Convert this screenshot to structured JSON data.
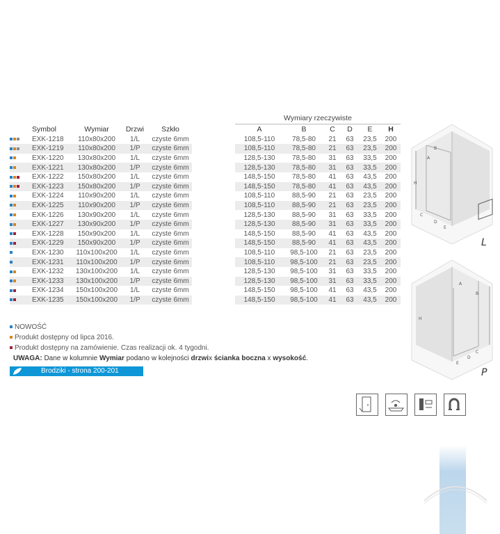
{
  "wymiary_title": "Wymiary rzeczywiste",
  "left_headers": [
    "Symbol",
    "Wymiar",
    "Drzwi",
    "Szkło"
  ],
  "right_headers": [
    "A",
    "B",
    "C",
    "D",
    "E",
    "H"
  ],
  "colors": {
    "nowosc": "#2a7fc1",
    "lipiec": "#d9841c",
    "zamowienie": "#a3203a",
    "gray": "#8a8a8a",
    "banner": "#0e96d6"
  },
  "rows": [
    {
      "symbol": "EXK-1218",
      "wymiar": "110x80x200",
      "drzwi": "1/L",
      "szklo": "czyste 6mm",
      "a": "108,5-110",
      "b": "78,5-80",
      "c": "21",
      "d": "63",
      "e": "23,5",
      "h": "200",
      "marks": [
        "nowosc",
        "lipiec",
        "gray"
      ]
    },
    {
      "symbol": "EXK-1219",
      "wymiar": "110x80x200",
      "drzwi": "1/P",
      "szklo": "czyste 6mm",
      "a": "108,5-110",
      "b": "78,5-80",
      "c": "21",
      "d": "63",
      "e": "23,5",
      "h": "200",
      "marks": [
        "nowosc",
        "lipiec",
        "gray"
      ]
    },
    {
      "symbol": "EXK-1220",
      "wymiar": "130x80x200",
      "drzwi": "1/L",
      "szklo": "czyste 6mm",
      "a": "128,5-130",
      "b": "78,5-80",
      "c": "31",
      "d": "63",
      "e": "33,5",
      "h": "200",
      "marks": [
        "nowosc",
        "lipiec"
      ]
    },
    {
      "symbol": "EXK-1221",
      "wymiar": "130x80x200",
      "drzwi": "1/P",
      "szklo": "czyste 6mm",
      "a": "128,5-130",
      "b": "78,5-80",
      "c": "31",
      "d": "63",
      "e": "33,5",
      "h": "200",
      "marks": [
        "nowosc",
        "lipiec"
      ]
    },
    {
      "symbol": "EXK-1222",
      "wymiar": "150x80x200",
      "drzwi": "1/L",
      "szklo": "czyste 6mm",
      "a": "148,5-150",
      "b": "78,5-80",
      "c": "41",
      "d": "63",
      "e": "43,5",
      "h": "200",
      "marks": [
        "nowosc",
        "lipiec",
        "zamowienie"
      ]
    },
    {
      "symbol": "EXK-1223",
      "wymiar": "150x80x200",
      "drzwi": "1/P",
      "szklo": "czyste 6mm",
      "a": "148,5-150",
      "b": "78,5-80",
      "c": "41",
      "d": "63",
      "e": "43,5",
      "h": "200",
      "marks": [
        "nowosc",
        "lipiec",
        "zamowienie"
      ]
    },
    {
      "symbol": "EXK-1224",
      "wymiar": "110x90x200",
      "drzwi": "1/L",
      "szklo": "czyste 6mm",
      "a": "108,5-110",
      "b": "88,5-90",
      "c": "21",
      "d": "63",
      "e": "23,5",
      "h": "200",
      "marks": [
        "nowosc",
        "lipiec"
      ]
    },
    {
      "symbol": "EXK-1225",
      "wymiar": "110x90x200",
      "drzwi": "1/P",
      "szklo": "czyste 6mm",
      "a": "108,5-110",
      "b": "88,5-90",
      "c": "21",
      "d": "63",
      "e": "23,5",
      "h": "200",
      "marks": [
        "nowosc",
        "lipiec"
      ]
    },
    {
      "symbol": "EXK-1226",
      "wymiar": "130x90x200",
      "drzwi": "1/L",
      "szklo": "czyste 6mm",
      "a": "128,5-130",
      "b": "88,5-90",
      "c": "31",
      "d": "63",
      "e": "33,5",
      "h": "200",
      "marks": [
        "nowosc",
        "lipiec"
      ]
    },
    {
      "symbol": "EXK-1227",
      "wymiar": "130x90x200",
      "drzwi": "1/P",
      "szklo": "czyste 6mm",
      "a": "128,5-130",
      "b": "88,5-90",
      "c": "31",
      "d": "63",
      "e": "33,5",
      "h": "200",
      "marks": [
        "nowosc",
        "lipiec"
      ]
    },
    {
      "symbol": "EXK-1228",
      "wymiar": "150x90x200",
      "drzwi": "1/L",
      "szklo": "czyste 6mm",
      "a": "148,5-150",
      "b": "88,5-90",
      "c": "41",
      "d": "63",
      "e": "43,5",
      "h": "200",
      "marks": [
        "nowosc",
        "zamowienie"
      ]
    },
    {
      "symbol": "EXK-1229",
      "wymiar": "150x90x200",
      "drzwi": "1/P",
      "szklo": "czyste 6mm",
      "a": "148,5-150",
      "b": "88,5-90",
      "c": "41",
      "d": "63",
      "e": "43,5",
      "h": "200",
      "marks": [
        "nowosc",
        "zamowienie"
      ]
    },
    {
      "symbol": "EXK-1230",
      "wymiar": "110x100x200",
      "drzwi": "1/L",
      "szklo": "czyste 6mm",
      "a": "108,5-110",
      "b": "98,5-100",
      "c": "21",
      "d": "63",
      "e": "23,5",
      "h": "200",
      "marks": [
        "nowosc"
      ]
    },
    {
      "symbol": "EXK-1231",
      "wymiar": "110x100x200",
      "drzwi": "1/P",
      "szklo": "czyste 6mm",
      "a": "108,5-110",
      "b": "98,5-100",
      "c": "21",
      "d": "63",
      "e": "23,5",
      "h": "200",
      "marks": [
        "nowosc"
      ]
    },
    {
      "symbol": "EXK-1232",
      "wymiar": "130x100x200",
      "drzwi": "1/L",
      "szklo": "czyste 6mm",
      "a": "128,5-130",
      "b": "98,5-100",
      "c": "31",
      "d": "63",
      "e": "33,5",
      "h": "200",
      "marks": [
        "nowosc",
        "lipiec"
      ]
    },
    {
      "symbol": "EXK-1233",
      "wymiar": "130x100x200",
      "drzwi": "1/P",
      "szklo": "czyste 6mm",
      "a": "128,5-130",
      "b": "98,5-100",
      "c": "31",
      "d": "63",
      "e": "33,5",
      "h": "200",
      "marks": [
        "nowosc",
        "lipiec"
      ]
    },
    {
      "symbol": "EXK-1234",
      "wymiar": "150x100x200",
      "drzwi": "1/L",
      "szklo": "czyste 6mm",
      "a": "148,5-150",
      "b": "98,5-100",
      "c": "41",
      "d": "63",
      "e": "43,5",
      "h": "200",
      "marks": [
        "nowosc",
        "zamowienie"
      ]
    },
    {
      "symbol": "EXK-1235",
      "wymiar": "150x100x200",
      "drzwi": "1/P",
      "szklo": "czyste 6mm",
      "a": "148,5-150",
      "b": "98,5-100",
      "c": "41",
      "d": "63",
      "e": "43,5",
      "h": "200",
      "marks": [
        "nowosc",
        "zamowienie"
      ]
    }
  ],
  "legend": {
    "nowosc": "NOWOŚĆ",
    "lipiec": "Produkt dostępny od lipca 2016.",
    "zamowienie": "Produkt dostępny na zamówienie. Czas realizacji ok. 4 tygodni."
  },
  "note": {
    "label": "UWAGA:",
    "part1": " Dane w kolumnie ",
    "kol": "Wymiar",
    "part2": " podano w kolejności ",
    "drzwi": "drzwi",
    "x1": "x ",
    "scianka": "ścianka boczna",
    "x2": " x ",
    "wys": "wysokość",
    "end": "."
  },
  "banner": "Brodziki - strona 200-201",
  "diagrams": {
    "left_letter": "L",
    "right_letter": "P",
    "labels": {
      "a": "A",
      "b": "B",
      "c": "C",
      "d": "D",
      "e": "E",
      "h": "H"
    }
  },
  "icons": [
    "door-icon",
    "shower-tray-icon",
    "glass-panel-icon",
    "magnet-icon"
  ]
}
